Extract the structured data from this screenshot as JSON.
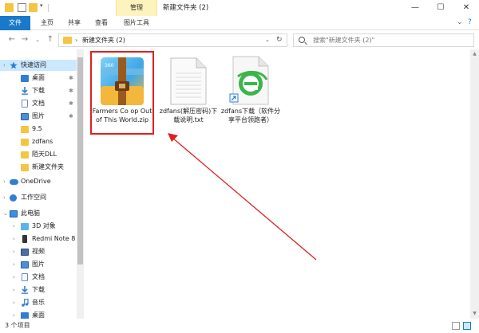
{
  "window": {
    "title": "新建文件夹 (2)",
    "context_tab_group": "管理",
    "controls": {
      "minimize": "—",
      "maximize": "☐",
      "close": "✕"
    }
  },
  "ribbon": {
    "tabs": [
      {
        "label": "文件"
      },
      {
        "label": "主页"
      },
      {
        "label": "共享"
      },
      {
        "label": "查看"
      },
      {
        "label": "图片工具"
      }
    ],
    "expand_glyph": "⌄",
    "help_glyph": "?"
  },
  "address": {
    "path": "新建文件夹 (2)",
    "chevron": "›",
    "dropdown": "⌄",
    "refresh": "↻",
    "search_placeholder": "搜索\"新建文件夹 (2)\""
  },
  "nav_glyphs": {
    "back": "←",
    "forward": "→",
    "recent": "⌄",
    "up": "↑"
  },
  "nav_pane": {
    "items": [
      {
        "label": "快速访问",
        "selected": true,
        "expand": "›",
        "icon": "star-icon"
      },
      {
        "label": "桌面",
        "pin": "✱",
        "icon": "desktop-icon"
      },
      {
        "label": "下载",
        "pin": "✱",
        "icon": "download-icon"
      },
      {
        "label": "文档",
        "pin": "✱",
        "icon": "document-icon"
      },
      {
        "label": "图片",
        "pin": "✱",
        "icon": "picture-icon"
      },
      {
        "label": "9.5",
        "icon": "folder-icon"
      },
      {
        "label": "zdfans",
        "icon": "folder-icon"
      },
      {
        "label": "陌天DLL",
        "icon": "folder-icon"
      },
      {
        "label": "新建文件夹",
        "icon": "folder-icon"
      },
      {
        "label": "OneDrive",
        "expand": "›",
        "icon": "cloud-icon"
      },
      {
        "label": "工作空间",
        "expand": "›",
        "icon": "workspace-icon"
      },
      {
        "label": "此电脑",
        "expand": "⌄",
        "icon": "computer-icon"
      },
      {
        "label": "3D 对象",
        "expand": "›",
        "icon": "3d-objects-icon"
      },
      {
        "label": "Redmi Note 8",
        "expand": "›",
        "icon": "phone-icon"
      },
      {
        "label": "视频",
        "expand": "›",
        "icon": "video-icon"
      },
      {
        "label": "图片",
        "expand": "›",
        "icon": "picture-icon"
      },
      {
        "label": "文档",
        "expand": "›",
        "icon": "document-icon"
      },
      {
        "label": "下载",
        "expand": "›",
        "icon": "download-icon"
      },
      {
        "label": "音乐",
        "expand": "›",
        "icon": "music-icon"
      },
      {
        "label": "桌面",
        "expand": "›",
        "icon": "desktop-icon"
      }
    ]
  },
  "files": [
    {
      "name": "Farmers Co op Out of This World.zip",
      "icon": "zip-archive-icon",
      "highlighted": true,
      "archive_brand": "360"
    },
    {
      "name": "zdfans(解压密码)下载说明.txt",
      "icon": "text-file-icon"
    },
    {
      "name": "zdfans下载（软件分享平台领跑者）",
      "icon": "browser-shortcut-icon"
    }
  ],
  "status_bar": {
    "item_count": "3 个项目"
  },
  "colors": {
    "accent": "#1979ca",
    "selection": "#cce8ff",
    "context_tab": "#fdf3bd",
    "annotation": "#e02020",
    "folder": "#f5c542"
  }
}
